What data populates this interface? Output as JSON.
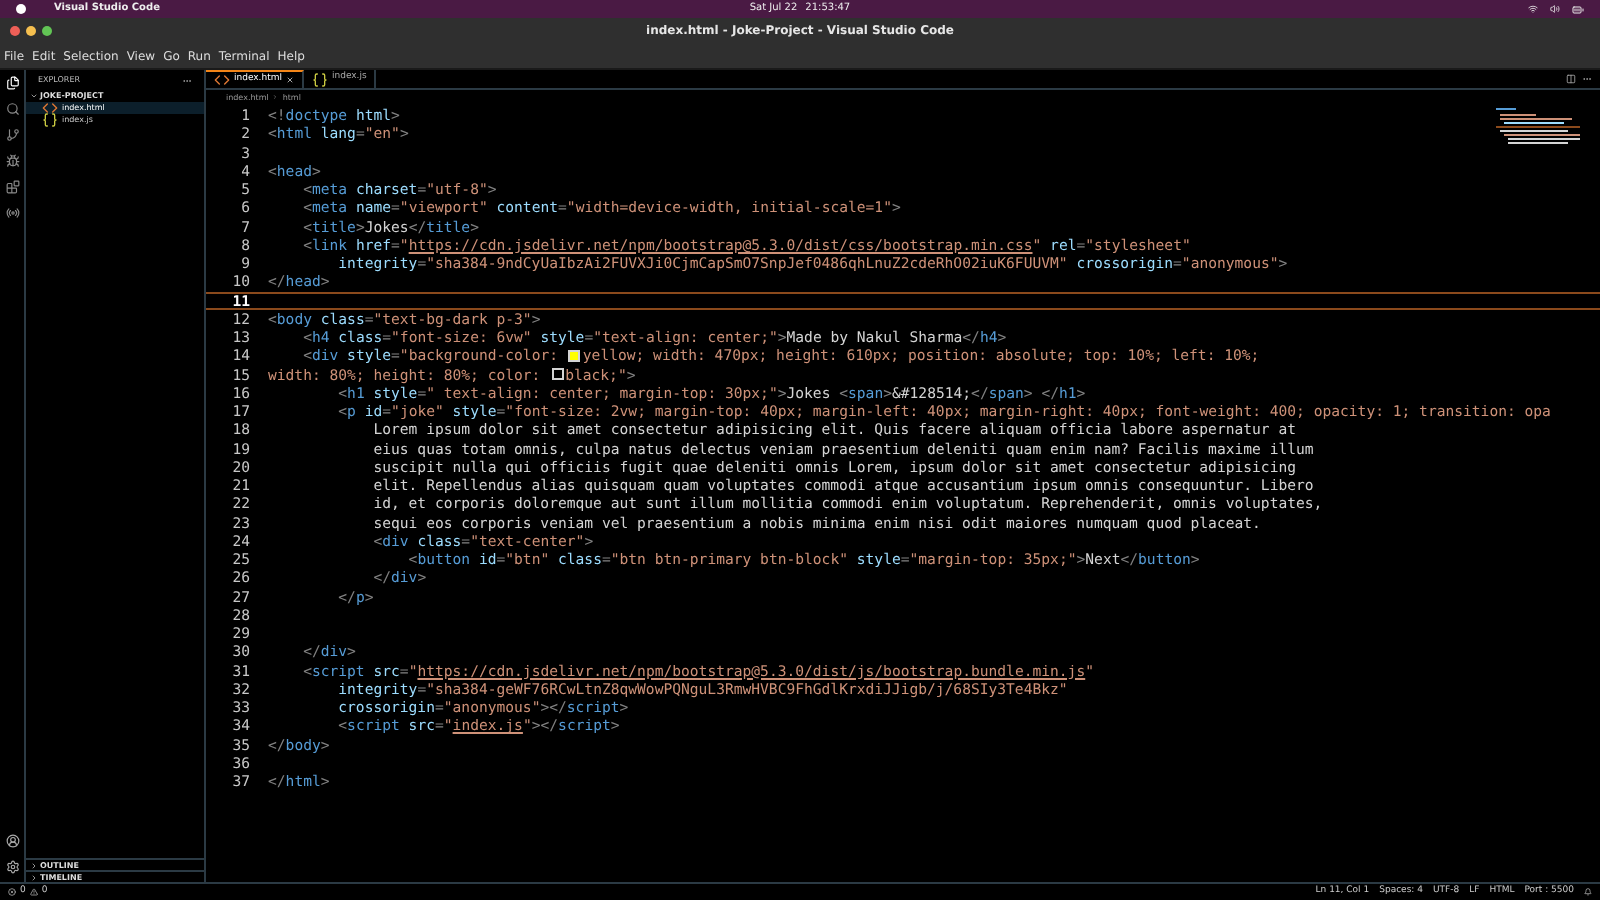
{
  "system_bar": {
    "app": "Visual Studio Code",
    "date": "Sat Jul 22",
    "time": "21:53:47"
  },
  "window": {
    "title": "index.html - Joke-Project - Visual Studio Code"
  },
  "menu": [
    "File",
    "Edit",
    "Selection",
    "View",
    "Go",
    "Run",
    "Terminal",
    "Help"
  ],
  "activity_bar": [
    {
      "kind": "files",
      "selected": true
    },
    {
      "kind": "search",
      "selected": false
    },
    {
      "kind": "source-control",
      "selected": false
    },
    {
      "kind": "debug",
      "selected": false
    },
    {
      "kind": "extensions",
      "selected": false
    },
    {
      "kind": "remote",
      "selected": false
    }
  ],
  "sidebar": {
    "title": "EXPLORER",
    "folder": {
      "name": "JOKE-PROJECT",
      "expanded": true,
      "files": [
        {
          "name": "index.html",
          "kind": "html",
          "selected": true
        },
        {
          "name": "index.js",
          "kind": "js",
          "selected": false
        }
      ]
    },
    "panels": [
      {
        "title": "OUTLINE",
        "expanded": false
      },
      {
        "title": "TIMELINE",
        "expanded": false
      }
    ]
  },
  "tabs": [
    {
      "label": "index.html",
      "kind": "html",
      "selected": true
    },
    {
      "label": "index.js",
      "kind": "js",
      "selected": false
    }
  ],
  "breadcrumb": [
    "index.html",
    "html"
  ],
  "editor": {
    "lines": [
      {
        "number": "1",
        "current": false,
        "tokens": [
          {
            "kind": "p",
            "text": "<!"
          },
          {
            "kind": "tag",
            "text": "doctype"
          },
          {
            "kind": "attr",
            "text": " html"
          },
          {
            "kind": "p",
            "text": ">"
          }
        ]
      },
      {
        "number": "2",
        "current": false,
        "tokens": [
          {
            "kind": "p",
            "text": "<"
          },
          {
            "kind": "tag",
            "text": "html"
          },
          {
            "kind": "attr",
            "text": " lang"
          },
          {
            "kind": "p",
            "text": "="
          },
          {
            "kind": "str",
            "text": "\"en\""
          },
          {
            "kind": "p",
            "text": ">"
          }
        ]
      },
      {
        "number": "3",
        "current": false
      },
      {
        "number": "4",
        "current": false,
        "tokens": [
          {
            "kind": "p",
            "text": "<"
          },
          {
            "kind": "tag",
            "text": "head"
          },
          {
            "kind": "p",
            "text": ">"
          }
        ]
      },
      {
        "number": "5",
        "current": false,
        "tokens": [
          {
            "kind": "p",
            "text": "    <"
          },
          {
            "kind": "tag",
            "text": "meta"
          },
          {
            "kind": "attr",
            "text": " charset"
          },
          {
            "kind": "p",
            "text": "="
          },
          {
            "kind": "str",
            "text": "\"utf-8\""
          },
          {
            "kind": "p",
            "text": ">"
          }
        ]
      },
      {
        "number": "6",
        "current": false,
        "tokens": [
          {
            "kind": "p",
            "text": "    <"
          },
          {
            "kind": "tag",
            "text": "meta"
          },
          {
            "kind": "attr",
            "text": " name"
          },
          {
            "kind": "p",
            "text": "="
          },
          {
            "kind": "str",
            "text": "\"viewport\""
          },
          {
            "kind": "attr",
            "text": " content"
          },
          {
            "kind": "p",
            "text": "="
          },
          {
            "kind": "str",
            "text": "\"width=device-width, initial-scale=1\""
          },
          {
            "kind": "p",
            "text": ">"
          }
        ]
      },
      {
        "number": "7",
        "current": false,
        "tokens": [
          {
            "kind": "p",
            "text": "    <"
          },
          {
            "kind": "tag",
            "text": "title"
          },
          {
            "kind": "p",
            "text": ">"
          },
          {
            "kind": "txt",
            "text": "Jokes"
          },
          {
            "kind": "p",
            "text": "</"
          },
          {
            "kind": "tag",
            "text": "title"
          },
          {
            "kind": "p",
            "text": ">"
          }
        ]
      },
      {
        "number": "8",
        "current": false,
        "tokens": [
          {
            "kind": "p",
            "text": "    <"
          },
          {
            "kind": "tag",
            "text": "link"
          },
          {
            "kind": "attr",
            "text": " href"
          },
          {
            "kind": "p",
            "text": "="
          },
          {
            "kind": "str",
            "text": "\""
          },
          {
            "kind": "url",
            "text": "https://cdn.jsdelivr.net/npm/bootstrap@5.3.0/dist/css/bootstrap.min.css"
          },
          {
            "kind": "str",
            "text": "\""
          },
          {
            "kind": "attr",
            "text": " rel"
          },
          {
            "kind": "p",
            "text": "="
          },
          {
            "kind": "str",
            "text": "\"stylesheet\""
          }
        ]
      },
      {
        "number": "9",
        "current": false,
        "tokens": [
          {
            "kind": "attr",
            "text": "        integrity"
          },
          {
            "kind": "p",
            "text": "="
          },
          {
            "kind": "str",
            "text": "\"sha384-9ndCyUaIbzAi2FUVXJi0CjmCapSmO7SnpJef0486qhLnuZ2cdeRhO02iuK6FUUVM\""
          },
          {
            "kind": "attr",
            "text": " crossorigin"
          },
          {
            "kind": "p",
            "text": "="
          },
          {
            "kind": "str",
            "text": "\"anonymous\""
          },
          {
            "kind": "p",
            "text": ">"
          }
        ]
      },
      {
        "number": "10",
        "current": false,
        "tokens": [
          {
            "kind": "p",
            "text": "</"
          },
          {
            "kind": "tag",
            "text": "head"
          },
          {
            "kind": "p",
            "text": ">"
          }
        ]
      },
      {
        "number": "11",
        "current": true
      },
      {
        "number": "12",
        "current": false,
        "tokens": [
          {
            "kind": "p",
            "text": "<"
          },
          {
            "kind": "tag",
            "text": "body"
          },
          {
            "kind": "attr",
            "text": " class"
          },
          {
            "kind": "p",
            "text": "="
          },
          {
            "kind": "str",
            "text": "\"text-bg-dark p-3\""
          },
          {
            "kind": "p",
            "text": ">"
          }
        ]
      },
      {
        "number": "13",
        "current": false,
        "tokens": [
          {
            "kind": "p",
            "text": "    <"
          },
          {
            "kind": "tag",
            "text": "h4"
          },
          {
            "kind": "attr",
            "text": " class"
          },
          {
            "kind": "p",
            "text": "="
          },
          {
            "kind": "str",
            "text": "\"font-size: 6vw\""
          },
          {
            "kind": "attr",
            "text": " style"
          },
          {
            "kind": "p",
            "text": "="
          },
          {
            "kind": "str",
            "text": "\"text-align: center;\""
          },
          {
            "kind": "p",
            "text": ">"
          },
          {
            "kind": "txt",
            "text": "Made by Nakul Sharma"
          },
          {
            "kind": "p",
            "text": "</"
          },
          {
            "kind": "tag",
            "text": "h4"
          },
          {
            "kind": "p",
            "text": ">"
          }
        ]
      },
      {
        "number": "14",
        "current": false,
        "tokens": [
          {
            "kind": "p",
            "text": "    <"
          },
          {
            "kind": "tag",
            "text": "div"
          },
          {
            "kind": "attr",
            "text": " style"
          },
          {
            "kind": "p",
            "text": "="
          },
          {
            "kind": "str",
            "text": "\"background-color: "
          },
          {
            "kind": "swatch",
            "color": "#ffff00"
          },
          {
            "kind": "str",
            "text": "yellow; width: 470px; height: 610px; position: absolute; top: 10%; left: 10%;"
          }
        ]
      },
      {
        "number": "15",
        "current": false,
        "tokens": [
          {
            "kind": "str",
            "text": "width: 80%; height: 80%; color: "
          },
          {
            "kind": "swatch",
            "color": "#000000"
          },
          {
            "kind": "str",
            "text": "black;\""
          },
          {
            "kind": "p",
            "text": ">"
          }
        ]
      },
      {
        "number": "16",
        "current": false,
        "tokens": [
          {
            "kind": "p",
            "text": "        <"
          },
          {
            "kind": "tag",
            "text": "h1"
          },
          {
            "kind": "attr",
            "text": " style"
          },
          {
            "kind": "p",
            "text": "="
          },
          {
            "kind": "str",
            "text": "\" text-align: center; margin-top: 30px;\""
          },
          {
            "kind": "p",
            "text": ">"
          },
          {
            "kind": "txt",
            "text": "Jokes "
          },
          {
            "kind": "p",
            "text": "<"
          },
          {
            "kind": "tag",
            "text": "span"
          },
          {
            "kind": "p",
            "text": ">"
          },
          {
            "kind": "txt",
            "text": "&#128514;"
          },
          {
            "kind": "p",
            "text": "</"
          },
          {
            "kind": "tag",
            "text": "span"
          },
          {
            "kind": "p",
            "text": "> </"
          },
          {
            "kind": "tag",
            "text": "h1"
          },
          {
            "kind": "p",
            "text": ">"
          }
        ]
      },
      {
        "number": "17",
        "current": false,
        "tokens": [
          {
            "kind": "p",
            "text": "        <"
          },
          {
            "kind": "tag",
            "text": "p"
          },
          {
            "kind": "attr",
            "text": " id"
          },
          {
            "kind": "p",
            "text": "="
          },
          {
            "kind": "str",
            "text": "\"joke\""
          },
          {
            "kind": "attr",
            "text": " style"
          },
          {
            "kind": "p",
            "text": "="
          },
          {
            "kind": "str",
            "text": "\"font-size: 2vw; margin-top: 40px; margin-left: 40px; margin-right: 40px; font-weight: 400; opacity: 1; transition: opa"
          }
        ]
      },
      {
        "number": "18",
        "current": false,
        "tokens": [
          {
            "kind": "txt",
            "text": "            Lorem ipsum dolor sit amet consectetur adipisicing elit. Quis facere aliquam officia labore aspernatur at"
          }
        ]
      },
      {
        "number": "19",
        "current": false,
        "tokens": [
          {
            "kind": "txt",
            "text": "            eius quas totam omnis, culpa natus delectus veniam praesentium deleniti quam enim nam? Facilis maxime illum"
          }
        ]
      },
      {
        "number": "20",
        "current": false,
        "tokens": [
          {
            "kind": "txt",
            "text": "            suscipit nulla qui officiis fugit quae deleniti omnis Lorem, ipsum dolor sit amet consectetur adipisicing"
          }
        ]
      },
      {
        "number": "21",
        "current": false,
        "tokens": [
          {
            "kind": "txt",
            "text": "            elit. Repellendus alias quisquam quam voluptates commodi atque accusantium ipsum omnis consequuntur. Libero"
          }
        ]
      },
      {
        "number": "22",
        "current": false,
        "tokens": [
          {
            "kind": "txt",
            "text": "            id, et corporis doloremque aut sunt illum mollitia commodi enim voluptatum. Reprehenderit, omnis voluptates,"
          }
        ]
      },
      {
        "number": "23",
        "current": false,
        "tokens": [
          {
            "kind": "txt",
            "text": "            sequi eos corporis veniam vel praesentium a nobis minima enim nisi odit maiores numquam quod placeat."
          }
        ]
      },
      {
        "number": "24",
        "current": false,
        "tokens": [
          {
            "kind": "p",
            "text": "            <"
          },
          {
            "kind": "tag",
            "text": "div"
          },
          {
            "kind": "attr",
            "text": " class"
          },
          {
            "kind": "p",
            "text": "="
          },
          {
            "kind": "str",
            "text": "\"text-center\""
          },
          {
            "kind": "p",
            "text": ">"
          }
        ]
      },
      {
        "number": "25",
        "current": false,
        "tokens": [
          {
            "kind": "p",
            "text": "                <"
          },
          {
            "kind": "tag",
            "text": "button"
          },
          {
            "kind": "attr",
            "text": " id"
          },
          {
            "kind": "p",
            "text": "="
          },
          {
            "kind": "str",
            "text": "\"btn\""
          },
          {
            "kind": "attr",
            "text": " class"
          },
          {
            "kind": "p",
            "text": "="
          },
          {
            "kind": "str",
            "text": "\"btn btn-primary btn-block\""
          },
          {
            "kind": "attr",
            "text": " style"
          },
          {
            "kind": "p",
            "text": "="
          },
          {
            "kind": "str",
            "text": "\"margin-top: 35px;\""
          },
          {
            "kind": "p",
            "text": ">"
          },
          {
            "kind": "txt",
            "text": "Next"
          },
          {
            "kind": "p",
            "text": "</"
          },
          {
            "kind": "tag",
            "text": "button"
          },
          {
            "kind": "p",
            "text": ">"
          }
        ]
      },
      {
        "number": "26",
        "current": false,
        "tokens": [
          {
            "kind": "p",
            "text": "            </"
          },
          {
            "kind": "tag",
            "text": "div"
          },
          {
            "kind": "p",
            "text": ">"
          }
        ]
      },
      {
        "number": "27",
        "current": false,
        "tokens": [
          {
            "kind": "p",
            "text": "        </"
          },
          {
            "kind": "tag",
            "text": "p"
          },
          {
            "kind": "p",
            "text": ">"
          }
        ]
      },
      {
        "number": "28",
        "current": false
      },
      {
        "number": "29",
        "current": false
      },
      {
        "number": "30",
        "current": false,
        "tokens": [
          {
            "kind": "p",
            "text": "    </"
          },
          {
            "kind": "tag",
            "text": "div"
          },
          {
            "kind": "p",
            "text": ">"
          }
        ]
      },
      {
        "number": "31",
        "current": false,
        "tokens": [
          {
            "kind": "p",
            "text": "    <"
          },
          {
            "kind": "tag",
            "text": "script"
          },
          {
            "kind": "attr",
            "text": " src"
          },
          {
            "kind": "p",
            "text": "="
          },
          {
            "kind": "str",
            "text": "\""
          },
          {
            "kind": "url",
            "text": "https://cdn.jsdelivr.net/npm/bootstrap@5.3.0/dist/js/bootstrap.bundle.min.js"
          },
          {
            "kind": "str",
            "text": "\""
          }
        ]
      },
      {
        "number": "32",
        "current": false,
        "tokens": [
          {
            "kind": "attr",
            "text": "        integrity"
          },
          {
            "kind": "p",
            "text": "="
          },
          {
            "kind": "str",
            "text": "\"sha384-geWF76RCwLtnZ8qwWowPQNguL3RmwHVBC9FhGdlKrxdiJJigb/j/68SIy3Te4Bkz\""
          }
        ]
      },
      {
        "number": "33",
        "current": false,
        "tokens": [
          {
            "kind": "attr",
            "text": "        crossorigin"
          },
          {
            "kind": "p",
            "text": "="
          },
          {
            "kind": "str",
            "text": "\"anonymous\""
          },
          {
            "kind": "p",
            "text": "></"
          },
          {
            "kind": "tag",
            "text": "script"
          },
          {
            "kind": "p",
            "text": ">"
          }
        ]
      },
      {
        "number": "34",
        "current": false,
        "tokens": [
          {
            "kind": "p",
            "text": "        <"
          },
          {
            "kind": "tag",
            "text": "script"
          },
          {
            "kind": "attr",
            "text": " src"
          },
          {
            "kind": "p",
            "text": "="
          },
          {
            "kind": "str",
            "text": "\""
          },
          {
            "kind": "url",
            "text": "index.js"
          },
          {
            "kind": "str",
            "text": "\""
          },
          {
            "kind": "p",
            "text": "></"
          },
          {
            "kind": "tag",
            "text": "script"
          },
          {
            "kind": "p",
            "text": ">"
          }
        ]
      },
      {
        "number": "35",
        "current": false,
        "tokens": [
          {
            "kind": "p",
            "text": "</"
          },
          {
            "kind": "tag",
            "text": "body"
          },
          {
            "kind": "p",
            "text": ">"
          }
        ]
      },
      {
        "number": "36",
        "current": false
      },
      {
        "number": "37",
        "current": false,
        "tokens": [
          {
            "kind": "p",
            "text": "</"
          },
          {
            "kind": "tag",
            "text": "html"
          },
          {
            "kind": "p",
            "text": ">"
          }
        ]
      }
    ]
  },
  "status_bar": {
    "errors": "0",
    "warnings": "0",
    "items": [
      "Ln 11, Col 1",
      "Spaces: 4",
      "UTF-8",
      "LF",
      "HTML",
      "Port : 5500"
    ]
  }
}
